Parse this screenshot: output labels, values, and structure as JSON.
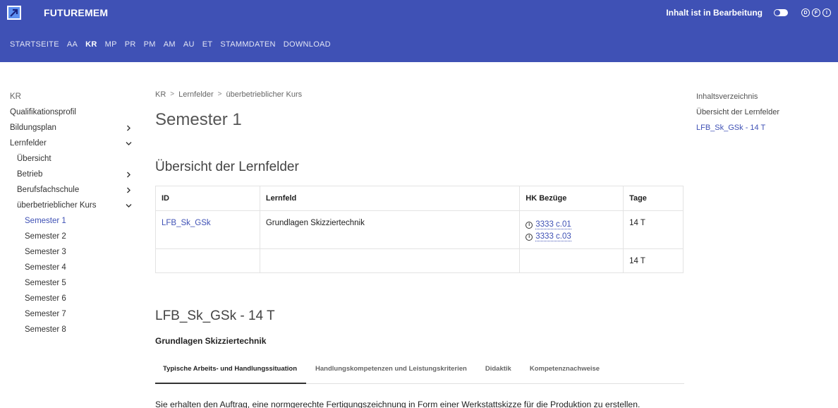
{
  "header": {
    "brand": "FUTUREMEM",
    "status": "Inhalt ist in Bearbeitung",
    "languages": [
      "D",
      "F",
      "I"
    ]
  },
  "nav": [
    "STARTSEITE",
    "AA",
    "KR",
    "MP",
    "PR",
    "PM",
    "AM",
    "AU",
    "ET",
    "STAMMDATEN",
    "DOWNLOAD"
  ],
  "nav_active": "KR",
  "sidebar": {
    "title": "KR",
    "items": [
      {
        "label": "Qualifikationsprofil"
      },
      {
        "label": "Bildungsplan",
        "chevron": ">"
      },
      {
        "label": "Lernfelder",
        "chevron": "v"
      },
      {
        "label": "Übersicht"
      },
      {
        "label": "Betrieb",
        "chevron": ">"
      },
      {
        "label": "Berufsfachschule",
        "chevron": ">"
      },
      {
        "label": "überbetrieblicher Kurs",
        "chevron": "v"
      },
      {
        "label": "Semester 1"
      },
      {
        "label": "Semester 2"
      },
      {
        "label": "Semester 3"
      },
      {
        "label": "Semester 4"
      },
      {
        "label": "Semester 5"
      },
      {
        "label": "Semester 6"
      },
      {
        "label": "Semester 7"
      },
      {
        "label": "Semester 8"
      }
    ]
  },
  "breadcrumb": [
    "KR",
    "Lernfelder",
    "überbetrieblicher Kurs"
  ],
  "page_title": "Semester 1",
  "overview": {
    "title": "Übersicht der Lernfelder",
    "headers": [
      "ID",
      "Lernfeld",
      "HK Bezüge",
      "Tage"
    ],
    "row": {
      "id": "LFB_Sk_GSk",
      "lernfeld": "Grundlagen Skizziertechnik",
      "hk": [
        "3333 c.01",
        "3333 c.03"
      ],
      "tage": "14 T"
    },
    "total_tage": "14 T"
  },
  "lernfeld": {
    "heading": "LFB_Sk_GSk - 14 T",
    "subtitle": "Grundlagen Skizziertechnik",
    "tabs": [
      "Typische Arbeits- und Handlungssituation",
      "Handlungskompetenzen und Leistungskriterien",
      "Didaktik",
      "Kompetenznachweise"
    ],
    "content": "Sie erhalten den Auftrag, eine normgerechte Fertigungszeichnung in Form einer Werkstattskizze für die Produktion zu erstellen."
  },
  "toc": {
    "title": "Inhaltsverzeichnis",
    "items": [
      "Übersicht der Lernfelder",
      "LFB_Sk_GSk - 14 T"
    ]
  },
  "colors": {
    "primary": "#3f51b5",
    "link": "#3f51b5"
  }
}
